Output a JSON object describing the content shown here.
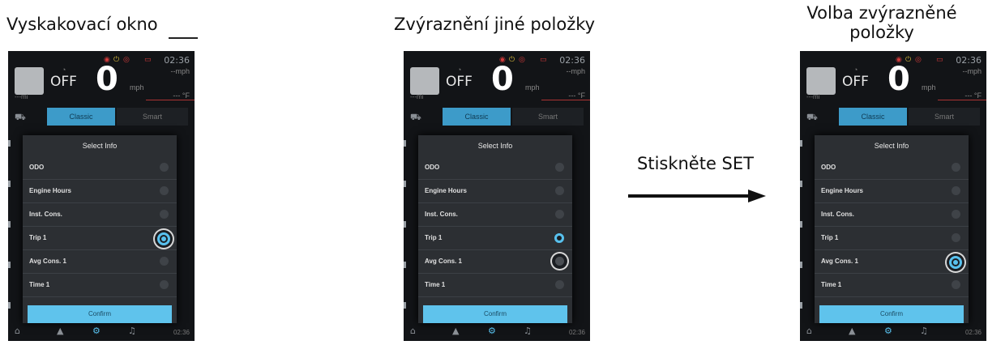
{
  "captions": {
    "c1": "Vyskakovací okno",
    "c2": "Zvýraznění jiné položky",
    "c3_line1": "Volba zvýrazněné",
    "c3_line2": "položky"
  },
  "instruction": "Stiskněte SET",
  "screen": {
    "clock": "02:36",
    "off": "OFF",
    "speed": "0",
    "unit": "mph",
    "top_unit": "--mph",
    "mi": "---mi",
    "temp": "--- °F",
    "tab_classic": "Classic",
    "tab_smart": "Smart",
    "popup_title": "Select Info",
    "items": [
      "ODO",
      "Engine Hours",
      "Inst. Cons.",
      "Trip 1",
      "Avg Cons. 1",
      "Time 1"
    ],
    "confirm": "Confirm",
    "bottom_clock": "02:36"
  },
  "states": {
    "screen1": {
      "checked": "Trip 1",
      "highlighted": "Trip 1"
    },
    "screen2": {
      "checked": "Trip 1",
      "highlighted": "Avg Cons. 1"
    },
    "screen3": {
      "checked": "Avg Cons. 1",
      "highlighted": "Avg Cons. 1"
    }
  },
  "colors": {
    "accent": "#58c1ee",
    "confirm": "#5fc3ec",
    "tab_active": "#3d9bc9",
    "screen_bg": "#121417"
  }
}
